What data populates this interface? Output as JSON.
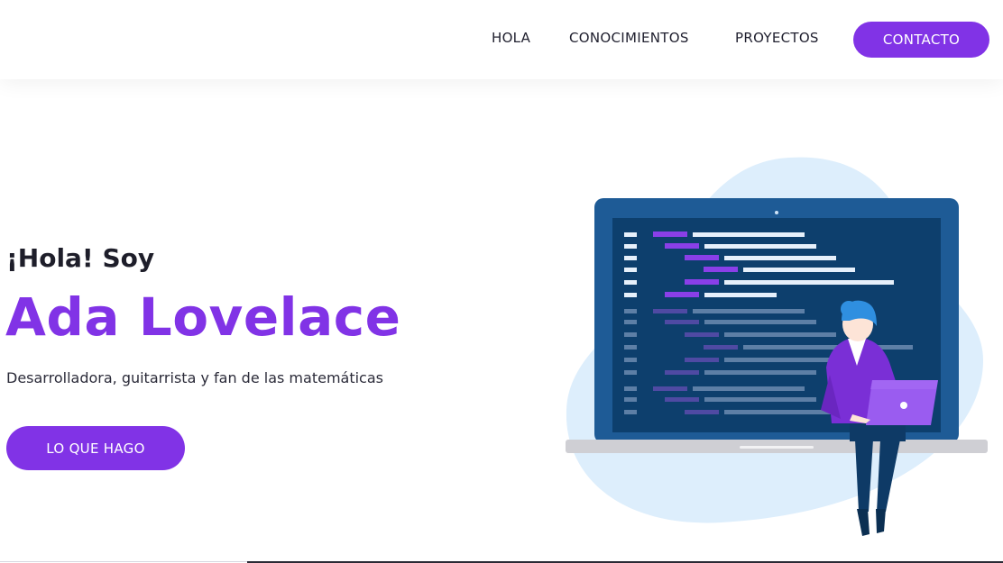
{
  "nav": {
    "items": [
      "HOLA",
      "CONOCIMIENTOS",
      "PROYECTOS"
    ],
    "cta": "CONTACTO"
  },
  "hero": {
    "greeting": "¡Hola! Soy",
    "name": "Ada Lovelace",
    "subtitle": "Desarrolladora, guitarrista y fan de las matemáticas",
    "button": "LO QUE HAGO"
  },
  "colors": {
    "accent": "#8133e6",
    "screen": "#0d4a7e",
    "blob": "#ddeefc"
  },
  "illustration": {
    "icon": "developer-laptop-illustration"
  }
}
